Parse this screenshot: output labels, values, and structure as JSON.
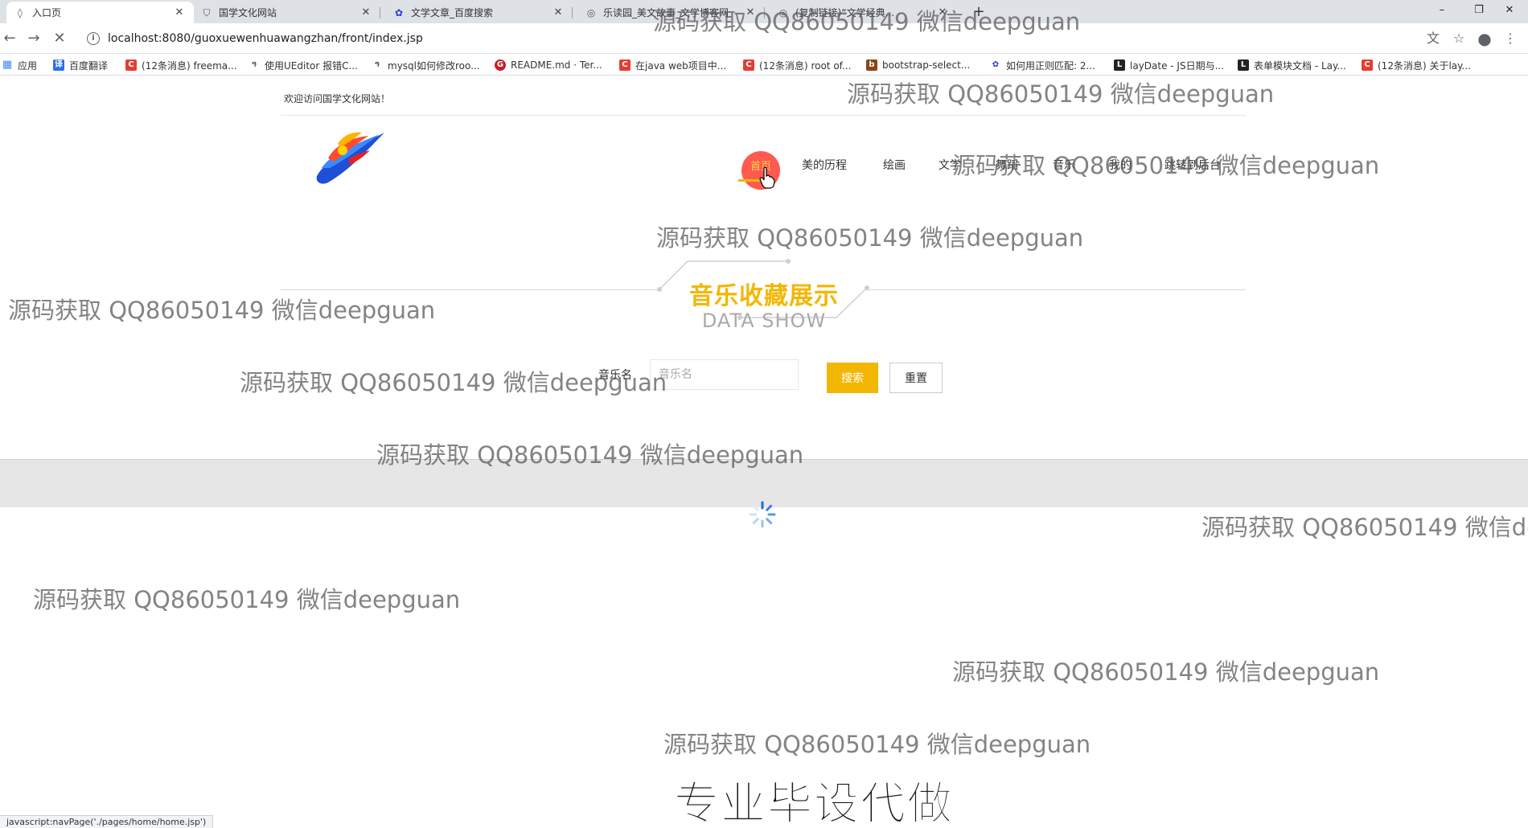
{
  "browser": {
    "tabs": [
      {
        "title": "入口页",
        "icon": "page-icon",
        "active": true
      },
      {
        "title": "国学文化网站",
        "icon": "shield-icon",
        "active": false
      },
      {
        "title": "文学文章_百度搜索",
        "icon": "baidu-paw-icon",
        "active": false
      },
      {
        "title": "乐读园_美文故事_文学博客网",
        "icon": "globe-icon",
        "active": false
      },
      {
        "title": "(复制链接)“文学经典...",
        "icon": "globe-icon",
        "active": false
      }
    ],
    "new_tab_label": "+",
    "window_controls": {
      "minimize": "–",
      "restore": "❐",
      "close": "✕"
    },
    "address": {
      "url": "localhost:8080/guoxuewenhuawangzhan/front/index.jsp"
    },
    "bookmarks": [
      {
        "label": "应用",
        "icon": "apps-grid-icon",
        "color": "#4285f4"
      },
      {
        "label": "百度翻译",
        "icon": "translate-icon",
        "color": "#2b6de8"
      },
      {
        "label": "(12条消息) freema...",
        "icon": "csdn-icon",
        "color": "#e33e33"
      },
      {
        "label": "使用UEditor 报错C...",
        "icon": "bird-icon",
        "color": "#555555"
      },
      {
        "label": "mysql如何修改roo...",
        "icon": "bird-icon",
        "color": "#555555"
      },
      {
        "label": "README.md · Ter...",
        "icon": "gitee-icon",
        "color": "#c71d23"
      },
      {
        "label": "在java web项目中...",
        "icon": "csdn-icon",
        "color": "#e33e33"
      },
      {
        "label": "(12条消息) root of...",
        "icon": "csdn-icon",
        "color": "#e33e33"
      },
      {
        "label": "bootstrap-select...",
        "icon": "bookmark-icon",
        "color": "#8b4513"
      },
      {
        "label": "如何用正则匹配: 2...",
        "icon": "baidu-paw-icon",
        "color": "#2932e1"
      },
      {
        "label": "layDate - JS日期与...",
        "icon": "layui-icon",
        "color": "#222222"
      },
      {
        "label": "表单模块文档 - Lay...",
        "icon": "layui-icon",
        "color": "#222222"
      },
      {
        "label": "(12条消息) 关于lay...",
        "icon": "csdn-icon",
        "color": "#e33e33"
      }
    ],
    "status_text": "javascript:navPage('./pages/home/home.jsp')"
  },
  "site": {
    "welcome": "欢迎访问国学文化网站！",
    "nav": [
      {
        "label": "首页",
        "active": true
      },
      {
        "label": "美的历程"
      },
      {
        "label": "绘画"
      },
      {
        "label": "文学"
      },
      {
        "label": "舞蹈"
      },
      {
        "label": "音乐"
      },
      {
        "label": "我的"
      },
      {
        "label": "跳转到后台"
      }
    ],
    "section": {
      "title": "音乐收藏展示",
      "subtitle": "DATA SHOW"
    },
    "search": {
      "label": "音乐名",
      "placeholder": "音乐名",
      "search_button": "搜索",
      "reset_button": "重置"
    },
    "accent_color": "#f2b705"
  },
  "watermark": {
    "text": "源码获取 QQ86050149 微信deepguan",
    "banner": "专业毕设代做"
  }
}
